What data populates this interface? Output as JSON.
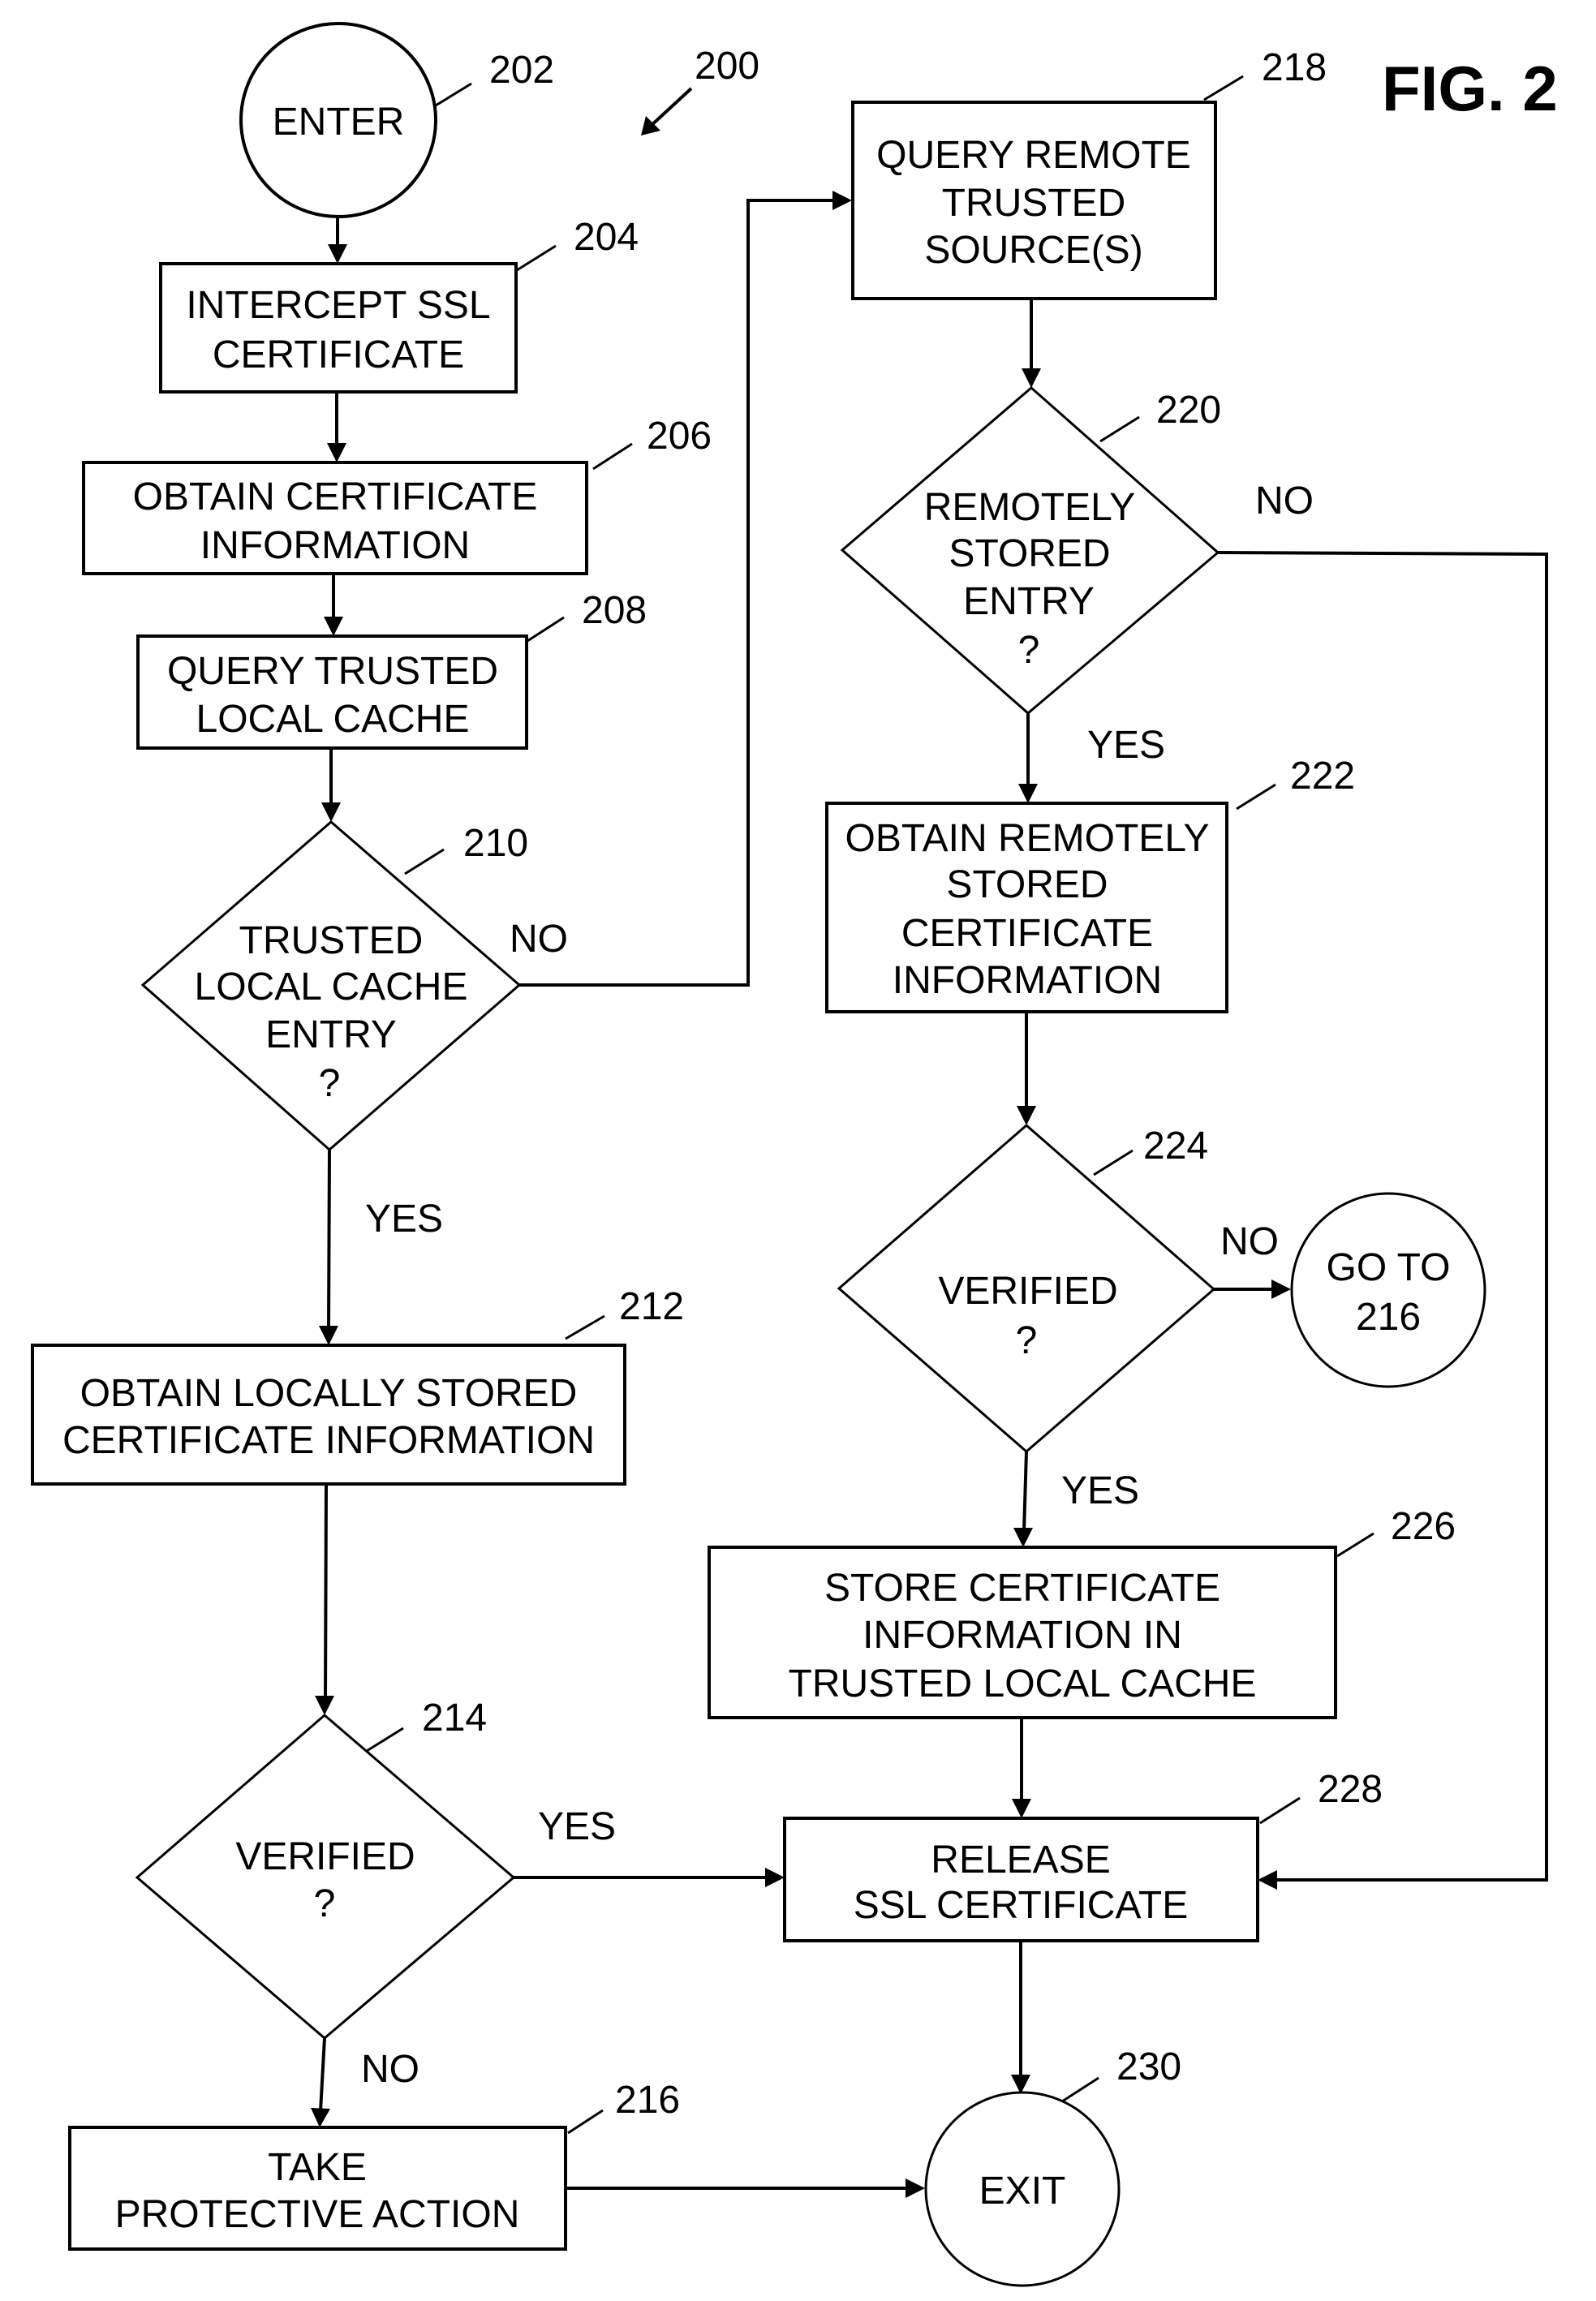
{
  "figure": {
    "title": "FIG. 2",
    "ref": "200"
  },
  "nodes": {
    "enter": {
      "ref": "202",
      "type": "terminal",
      "lines": [
        "ENTER"
      ]
    },
    "intercept": {
      "ref": "204",
      "type": "process",
      "lines": [
        "INTERCEPT SSL",
        "CERTIFICATE"
      ]
    },
    "obtain_info": {
      "ref": "206",
      "type": "process",
      "lines": [
        "OBTAIN CERTIFICATE",
        "INFORMATION"
      ]
    },
    "query_local": {
      "ref": "208",
      "type": "process",
      "lines": [
        "QUERY TRUSTED",
        "LOCAL CACHE"
      ]
    },
    "local_entry": {
      "ref": "210",
      "type": "decision",
      "lines": [
        "TRUSTED",
        "LOCAL CACHE",
        "ENTRY",
        "?"
      ]
    },
    "obtain_local": {
      "ref": "212",
      "type": "process",
      "lines": [
        "OBTAIN LOCALLY STORED",
        "CERTIFICATE INFORMATION"
      ]
    },
    "verified_local": {
      "ref": "214",
      "type": "decision",
      "lines": [
        "VERIFIED",
        "?"
      ]
    },
    "protective": {
      "ref": "216",
      "type": "process",
      "lines": [
        "TAKE",
        "PROTECTIVE ACTION"
      ]
    },
    "query_remote": {
      "ref": "218",
      "type": "process",
      "lines": [
        "QUERY REMOTE",
        "TRUSTED",
        "SOURCE(S)"
      ]
    },
    "remote_entry": {
      "ref": "220",
      "type": "decision",
      "lines": [
        "REMOTELY",
        "STORED",
        "ENTRY",
        "?"
      ]
    },
    "obtain_remote": {
      "ref": "222",
      "type": "process",
      "lines": [
        "OBTAIN REMOTELY",
        "STORED",
        "CERTIFICATE",
        "INFORMATION"
      ]
    },
    "verified_remote": {
      "ref": "224",
      "type": "decision",
      "lines": [
        "VERIFIED",
        "?"
      ]
    },
    "goto": {
      "type": "connector",
      "lines": [
        "GO TO",
        "216"
      ]
    },
    "store": {
      "ref": "226",
      "type": "process",
      "lines": [
        "STORE CERTIFICATE",
        "INFORMATION IN",
        "TRUSTED LOCAL CACHE"
      ]
    },
    "release": {
      "ref": "228",
      "type": "process",
      "lines": [
        "RELEASE",
        "SSL CERTIFICATE"
      ]
    },
    "exit": {
      "ref": "230",
      "type": "terminal",
      "lines": [
        "EXIT"
      ]
    }
  },
  "edges": [
    {
      "from": "enter",
      "to": "intercept",
      "label": ""
    },
    {
      "from": "intercept",
      "to": "obtain_info",
      "label": ""
    },
    {
      "from": "obtain_info",
      "to": "query_local",
      "label": ""
    },
    {
      "from": "query_local",
      "to": "local_entry",
      "label": ""
    },
    {
      "from": "local_entry",
      "to": "query_remote",
      "label": "NO"
    },
    {
      "from": "local_entry",
      "to": "obtain_local",
      "label": "YES"
    },
    {
      "from": "obtain_local",
      "to": "verified_local",
      "label": ""
    },
    {
      "from": "verified_local",
      "to": "release",
      "label": "YES"
    },
    {
      "from": "verified_local",
      "to": "protective",
      "label": "NO"
    },
    {
      "from": "protective",
      "to": "exit",
      "label": ""
    },
    {
      "from": "query_remote",
      "to": "remote_entry",
      "label": ""
    },
    {
      "from": "remote_entry",
      "to": "release",
      "label": "NO"
    },
    {
      "from": "remote_entry",
      "to": "obtain_remote",
      "label": "YES"
    },
    {
      "from": "obtain_remote",
      "to": "verified_remote",
      "label": ""
    },
    {
      "from": "verified_remote",
      "to": "goto",
      "label": "NO"
    },
    {
      "from": "verified_remote",
      "to": "store",
      "label": "YES"
    },
    {
      "from": "store",
      "to": "release",
      "label": ""
    },
    {
      "from": "release",
      "to": "exit",
      "label": ""
    }
  ]
}
